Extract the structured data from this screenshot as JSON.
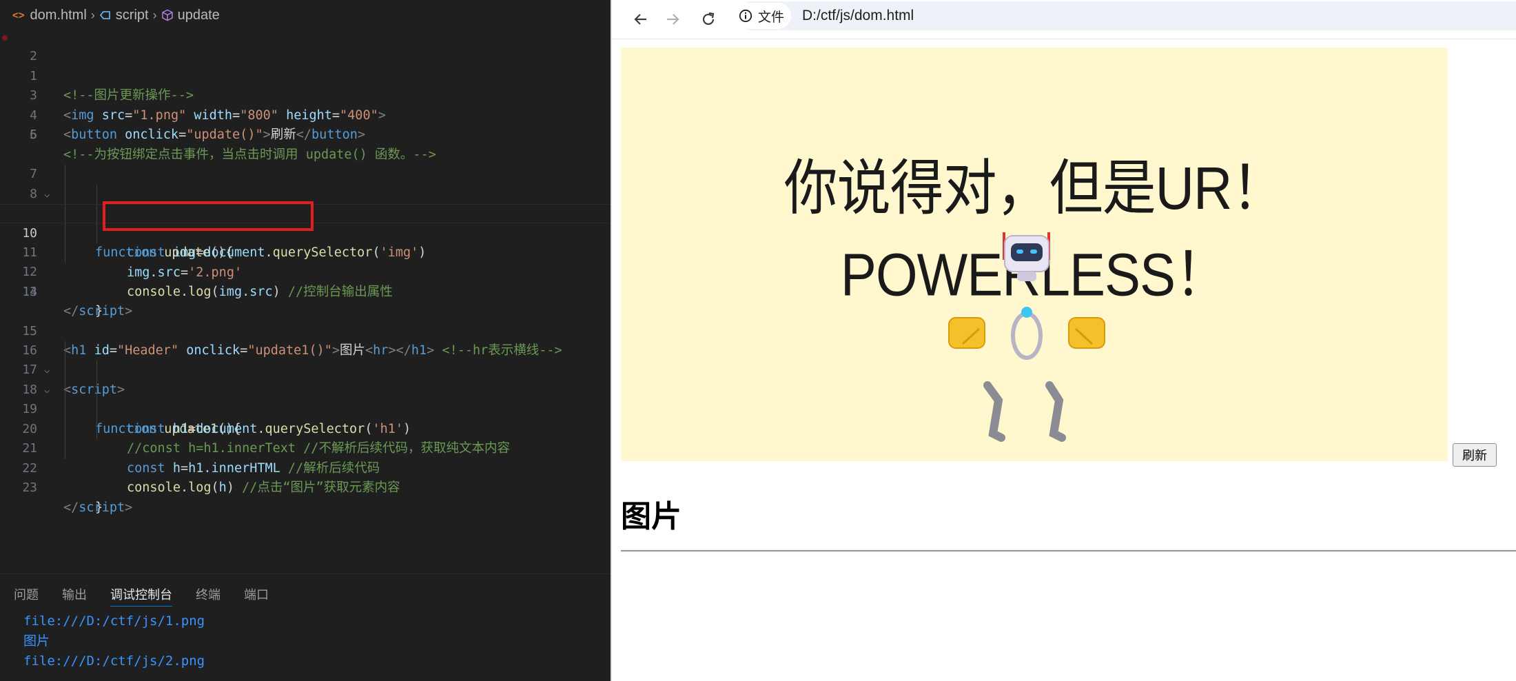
{
  "editor": {
    "breadcrumb": {
      "file": "dom.html",
      "section": "script",
      "symbol": "update"
    },
    "code": {
      "l1": "<!--图片更新操作-->",
      "l3_tag": "img",
      "l3_a1": "src",
      "l3_v1": "\"1.png\"",
      "l3_a2": "width",
      "l3_v2": "\"800\"",
      "l3_a3": "height",
      "l3_v3": "\"400\"",
      "l4_tag": "button",
      "l4_a1": "onclick",
      "l4_v1": "\"update()\"",
      "l4_text": "刷新",
      "l4_close": "button",
      "l5": "<!--为按钮绑定点击事件，当点击时调用 update() 函数。-->",
      "l7": "script",
      "l8_kw": "function",
      "l8_fn": "update",
      "l8_rest": "(){",
      "l9_kw": "const",
      "l9_var": "img",
      "l9_eq": "=",
      "l9_obj": "document",
      "l9_dot": ".",
      "l9_fn": "querySelector",
      "l9_p1": "(",
      "l9_str": "'img'",
      "l9_p2": ")",
      "l10_var": "img",
      "l10_prop": ".src",
      "l10_eq": "=",
      "l10_str": "'2.png'",
      "l11_fn": "console.log",
      "l11_args_open": "(",
      "l11_var": "img.src",
      "l11_args_close": ") ",
      "l11_comment": "//控制台输出属性",
      "l12": "}",
      "l13": "script",
      "l15_tag": "h1",
      "l15_a1": "id",
      "l15_v1": "\"Header\"",
      "l15_a2": "onclick",
      "l15_v2": "\"update1()\"",
      "l15_text": "图片",
      "l15_hr": "hr",
      "l15_close": "h1",
      "l15_comment": "<!--hr表示横线-->",
      "l16": "script",
      "l17_kw": "function",
      "l17_fn": "update1",
      "l17_rest": "(){",
      "l18_kw": "const",
      "l18_var": "h1",
      "l18_eq": "=",
      "l18_obj": "document",
      "l18_fn": "querySelector",
      "l18_str": "'h1'",
      "l19": "//const h=h1.innerText //不解析后续代码，获取纯文本内容",
      "l20_kw": "const",
      "l20_var": "h",
      "l20_eq": "=",
      "l20_rhs": "h1.innerHTML",
      "l20_comment": "//解析后续代码",
      "l21_fn": "console.log",
      "l21_var": "h",
      "l21_comment": "//点击“图片”获取元素内容",
      "l22": "}",
      "l23": "script"
    }
  },
  "panel": {
    "tabs": [
      "问题",
      "输出",
      "调试控制台",
      "终端",
      "端口"
    ],
    "active_tab": "调试控制台",
    "console": [
      "file:///D:/ctf/js/1.png",
      "图片",
      "file:///D:/ctf/js/2.png"
    ]
  },
  "browser": {
    "info_chip": "文件",
    "url": "D:/ctf/js/dom.html",
    "image_caption": "你说得对，但是UR！POWERLESS！",
    "refresh_button": "刷新",
    "heading": "图片"
  },
  "colors": {
    "editor_bg": "#1f1f1f",
    "highlight": "#e02020",
    "meme_bg": "#fff8cf",
    "console_text": "#3794ff"
  }
}
